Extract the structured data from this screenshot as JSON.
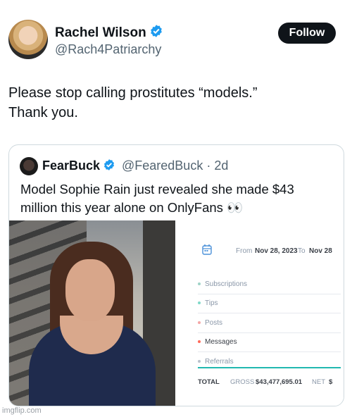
{
  "tweet": {
    "author_name": "Rachel Wilson",
    "author_handle": "@Rach4Patriarchy",
    "follow_label": "Follow",
    "text_line1": "Please stop calling prostitutes “models.”",
    "text_line2": "Thank you."
  },
  "quoted": {
    "author_name": "FearBuck",
    "handle_time": "@FearedBuck · 2d",
    "text_line1": "Model Sophie Rain just revealed she made $43",
    "text_line2": "million this year alone on OnlyFans 👀"
  },
  "dashboard": {
    "from_label": "From",
    "from_date": "Nov 28, 2023",
    "to_label": "To",
    "to_date": "Nov 28",
    "categories": [
      {
        "label": "Subscriptions",
        "color": "#9fd3c7"
      },
      {
        "label": "Tips",
        "color": "#7fd8c8"
      },
      {
        "label": "Posts",
        "color": "#f4a6a6"
      },
      {
        "label": "Messages",
        "color": "#ff6a5a"
      },
      {
        "label": "Referrals",
        "color": "#b9c2cc"
      }
    ],
    "total_label": "TOTAL",
    "gross_label": "GROSS",
    "gross_value": "$43,477,695.01",
    "net_label": "NET",
    "net_value": "$"
  },
  "colors": {
    "verified": "#1d9bf0",
    "follow_bg": "#0f1419",
    "accent_line": "#22b8b0"
  },
  "watermark": "imgflip.com"
}
